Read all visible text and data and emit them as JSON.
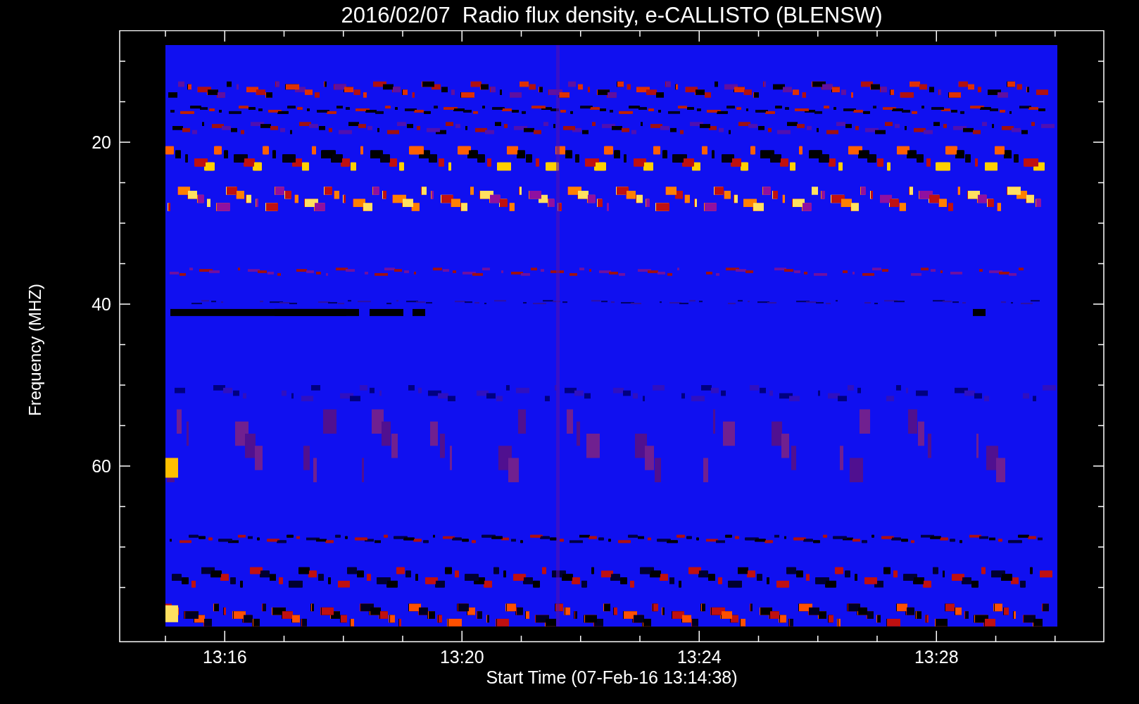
{
  "title": "2016/02/07  Radio flux density, e-CALLISTO (BLENSW)",
  "y_axis": {
    "label": "Frequency (MHZ)",
    "ticks": [
      "20",
      "40",
      "60"
    ]
  },
  "x_axis": {
    "label": "Start Time (07-Feb-16 13:14:38)",
    "ticks": [
      "13:16",
      "13:20",
      "13:24",
      "13:28"
    ]
  }
}
